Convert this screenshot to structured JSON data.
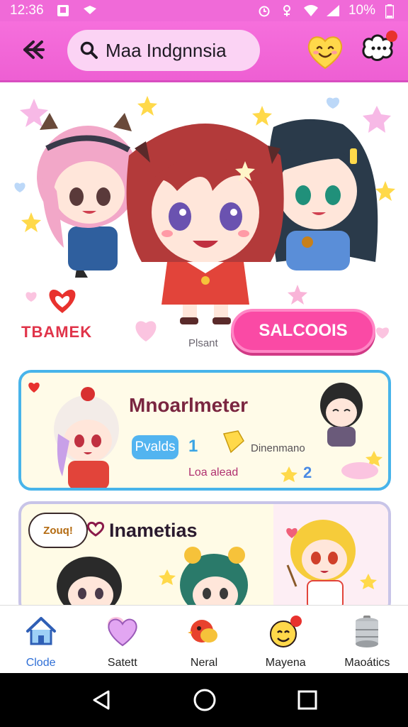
{
  "status_bar": {
    "time": "12:36",
    "battery": "10%"
  },
  "app_bar": {
    "search_value": "Maa Indgnnsia",
    "search_placeholder": "Maa Indgnnsia"
  },
  "hero": {
    "team_label": "TBAMEK",
    "caption": "Plsant",
    "button_label": "SALCOOIS"
  },
  "card1": {
    "title": "Mnoarlmeter",
    "pill_label": "Pvalds",
    "count_1": "1",
    "sub_label": "Dinenmano",
    "sub_label_2": "Loa alead",
    "count_2": "2"
  },
  "card2": {
    "bubble_text": "Zouq!",
    "title": "Inametias"
  },
  "bottom_nav": [
    {
      "label": "Clode",
      "icon": "home-icon",
      "active": true
    },
    {
      "label": "Satett",
      "icon": "heart-icon",
      "active": false
    },
    {
      "label": "Neral",
      "icon": "bird-icon",
      "active": false
    },
    {
      "label": "Mayena",
      "icon": "smile-notification-icon",
      "active": false
    },
    {
      "label": "Maoátics",
      "icon": "canister-icon",
      "active": false
    }
  ],
  "colors": {
    "primary_pink": "#f06ad8",
    "button_pink": "#fa4aa5",
    "card_blue": "#48b4ea",
    "active_nav": "#2f6fd6"
  }
}
